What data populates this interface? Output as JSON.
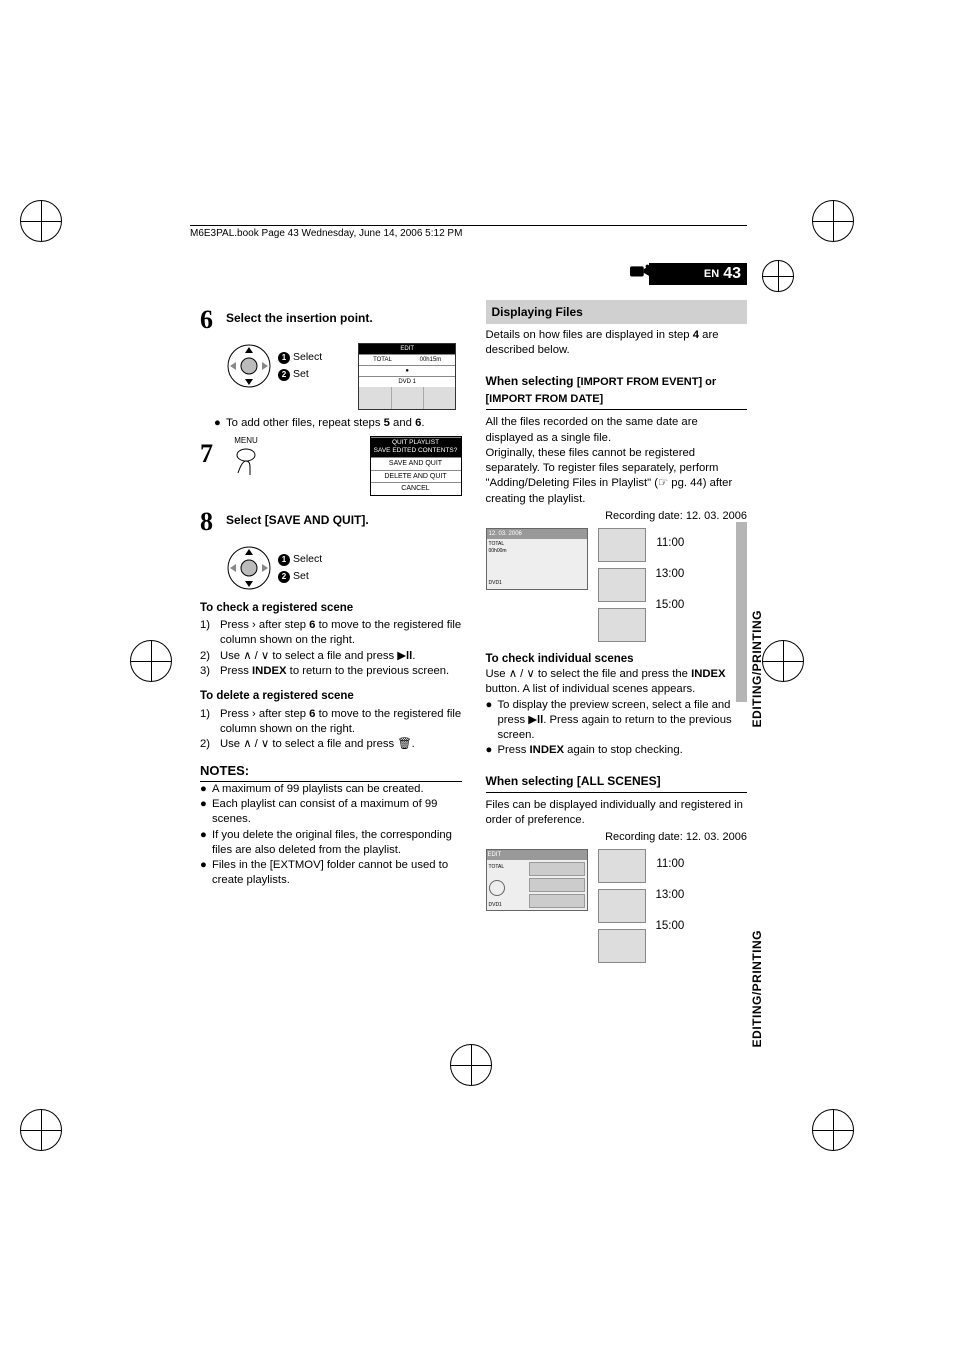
{
  "header_line": "M6E3PAL.book  Page 43  Wednesday, June 14, 2006  5:12 PM",
  "page_lang": "EN",
  "page_num": "43",
  "side_tab": "EDITING/PRINTING",
  "side_tab2": "EDITING/PRINTING",
  "left": {
    "step6": {
      "num": "6",
      "title": "Select the insertion point.",
      "sel": "Select",
      "set": "Set",
      "lcd_hdr": "EDIT",
      "lcd_total": "TOTAL",
      "lcd_time": "00h15m",
      "lcd_dvd": "DVD 1",
      "add_other": "To add other files, repeat steps ",
      "add_other_b1": "5",
      "add_other_mid": " and ",
      "add_other_b2": "6",
      "add_other_end": "."
    },
    "step7": {
      "num": "7",
      "menu_label": "MENU",
      "m_hdr": "QUIT PLAYLIST",
      "m_sub": "SAVE EDITED CONTENTS?",
      "m_save": "SAVE AND QUIT",
      "m_del": "DELETE AND QUIT",
      "m_cancel": "CANCEL"
    },
    "step8": {
      "num": "8",
      "title": "Select [SAVE AND QUIT].",
      "sel": "Select",
      "set": "Set"
    },
    "check_hdr": "To check a registered scene",
    "c1a": "Press ",
    "c1b": " after step ",
    "c1bold": "6",
    "c1c": " to move to the registered file column shown on the right.",
    "c2a": "Use ",
    "c2b": " to select a file and press ",
    "c2c": ".",
    "c3a": "Press ",
    "c3bold": "INDEX",
    "c3b": " to return to the previous screen.",
    "del_hdr": "To delete a registered scene",
    "d1a": "Press ",
    "d1b": " after step ",
    "d1bold": "6",
    "d1c": " to move to the registered file column shown on the right.",
    "d2a": "Use ",
    "d2b": " to select a file and press ",
    "d2c": ".",
    "notes_hdr": "NOTES:",
    "n1": "A maximum of 99 playlists can be created.",
    "n2": "Each playlist can consist of a maximum of 99 scenes.",
    "n3": "If you delete the original files, the corresponding files are also deleted from the playlist.",
    "n4": "Files in the [EXTMOV] folder cannot be used to create playlists."
  },
  "right": {
    "disp_hdr": "Displaying Files",
    "disp_body_a": "Details on how files are displayed in step ",
    "disp_body_bold": "4",
    "disp_body_b": " are described below.",
    "sec1_hdr_a": "When selecting ",
    "sec1_hdr_b": "[IMPORT FROM EVENT] or [IMPORT FROM DATE]",
    "sec1_p1": "All the files recorded on the same date are displayed as a single file.",
    "sec1_p2a": "Originally, these files cannot be registered separately. To register files separately, perform \"Adding/Deleting Files in Playlist\" (",
    "sec1_p2b": " pg. 44) after creating the playlist.",
    "rec_date": "Recording date: 12. 03. 2006",
    "lcd2_date": "12. 03. 2006",
    "lcd2_total": "TOTAL",
    "lcd2_time": "00h00m",
    "lcd2_dvd": "DVD1",
    "t1": "11:00",
    "t2": "13:00",
    "t3": "15:00",
    "indiv_hdr": "To check individual scenes",
    "indiv_a": "Use ",
    "indiv_b": " to select the file and press the ",
    "indiv_bold": "INDEX",
    "indiv_c": " button. A list of individual scenes appears.",
    "indiv_bul1a": "To display the preview screen, select a file and press ",
    "indiv_bul1b": ". Press again to return to the previous screen.",
    "indiv_bul2a": "Press ",
    "indiv_bul2bold": "INDEX",
    "indiv_bul2b": " again to stop checking.",
    "sec2_hdr": "When selecting [ALL SCENES]",
    "sec2_body": "Files can be displayed individually and registered in order of preference.",
    "rec_date2": "Recording date: 12. 03. 2006",
    "lcd3_hdr": "EDIT",
    "lcd3_total": "TOTAL",
    "lcd3_dvd": "DVD1",
    "t21": "11:00",
    "t22": "13:00",
    "t23": "15:00"
  }
}
